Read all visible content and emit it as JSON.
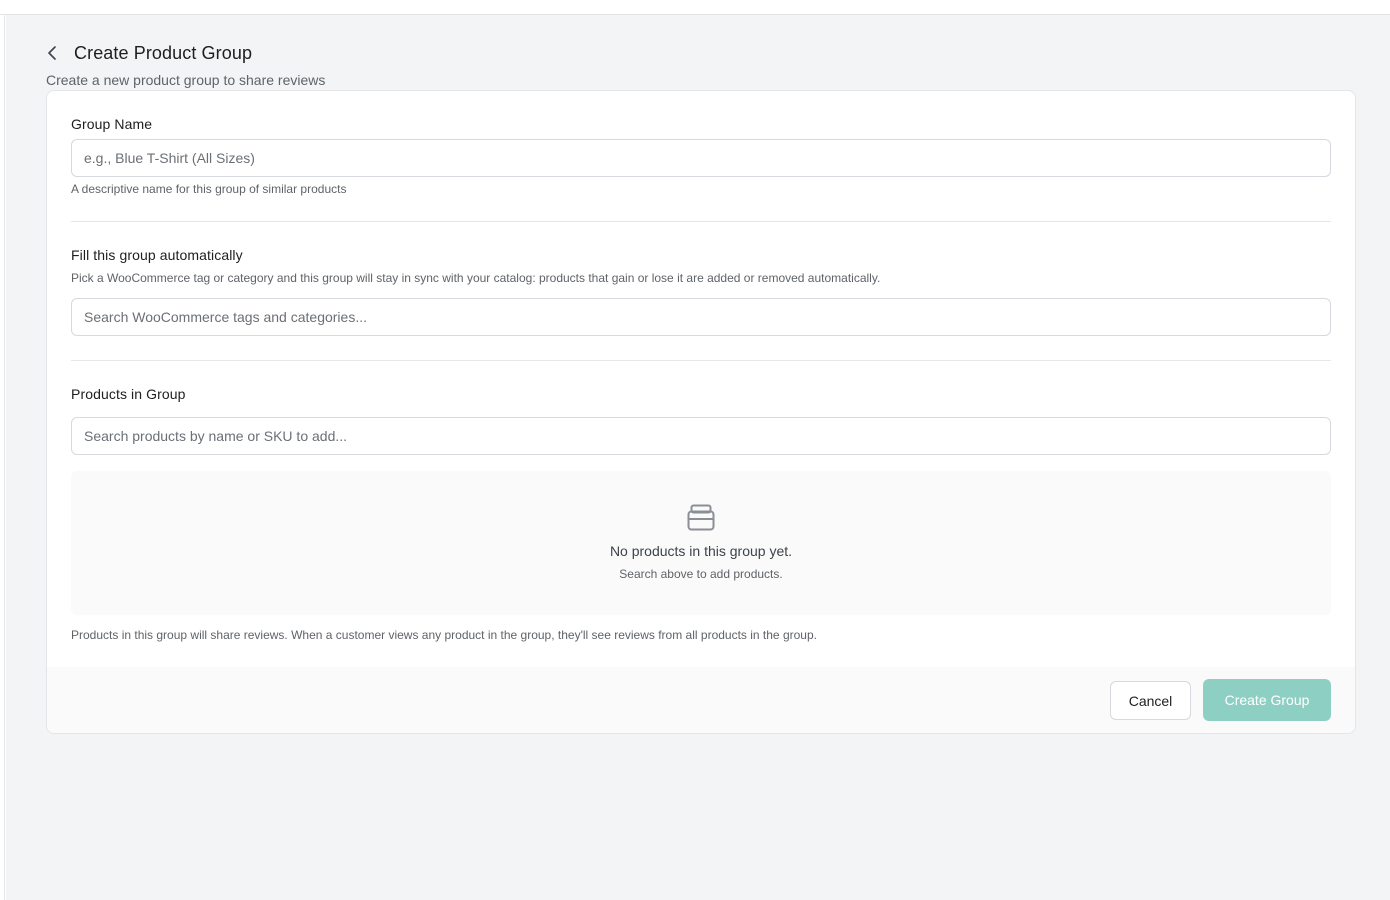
{
  "header": {
    "title": "Create Product Group",
    "subtitle": "Create a new product group to share reviews"
  },
  "group_name": {
    "label": "Group Name",
    "placeholder": "e.g., Blue T-Shirt (All Sizes)",
    "value": "",
    "help": "A descriptive name for this group of similar products"
  },
  "auto_fill": {
    "label": "Fill this group automatically",
    "help": "Pick a WooCommerce tag or category and this group will stay in sync with your catalog: products that gain or lose it are added or removed automatically.",
    "placeholder": "Search WooCommerce tags and categories...",
    "value": ""
  },
  "products": {
    "label": "Products in Group",
    "placeholder": "Search products by name or SKU to add...",
    "value": "",
    "empty_icon": "archive-box-icon",
    "empty_title": "No products in this group yet.",
    "empty_subtitle": "Search above to add products.",
    "footnote": "Products in this group will share reviews. When a customer views any product in the group, they'll see reviews from all products in the group."
  },
  "footer": {
    "cancel_label": "Cancel",
    "create_label": "Create Group"
  },
  "colors": {
    "primary_disabled": "#8ecfc4",
    "page_background": "#f3f4f6",
    "border": "#d6d9dd"
  },
  "icons": {
    "back": "chevron-left-icon"
  }
}
